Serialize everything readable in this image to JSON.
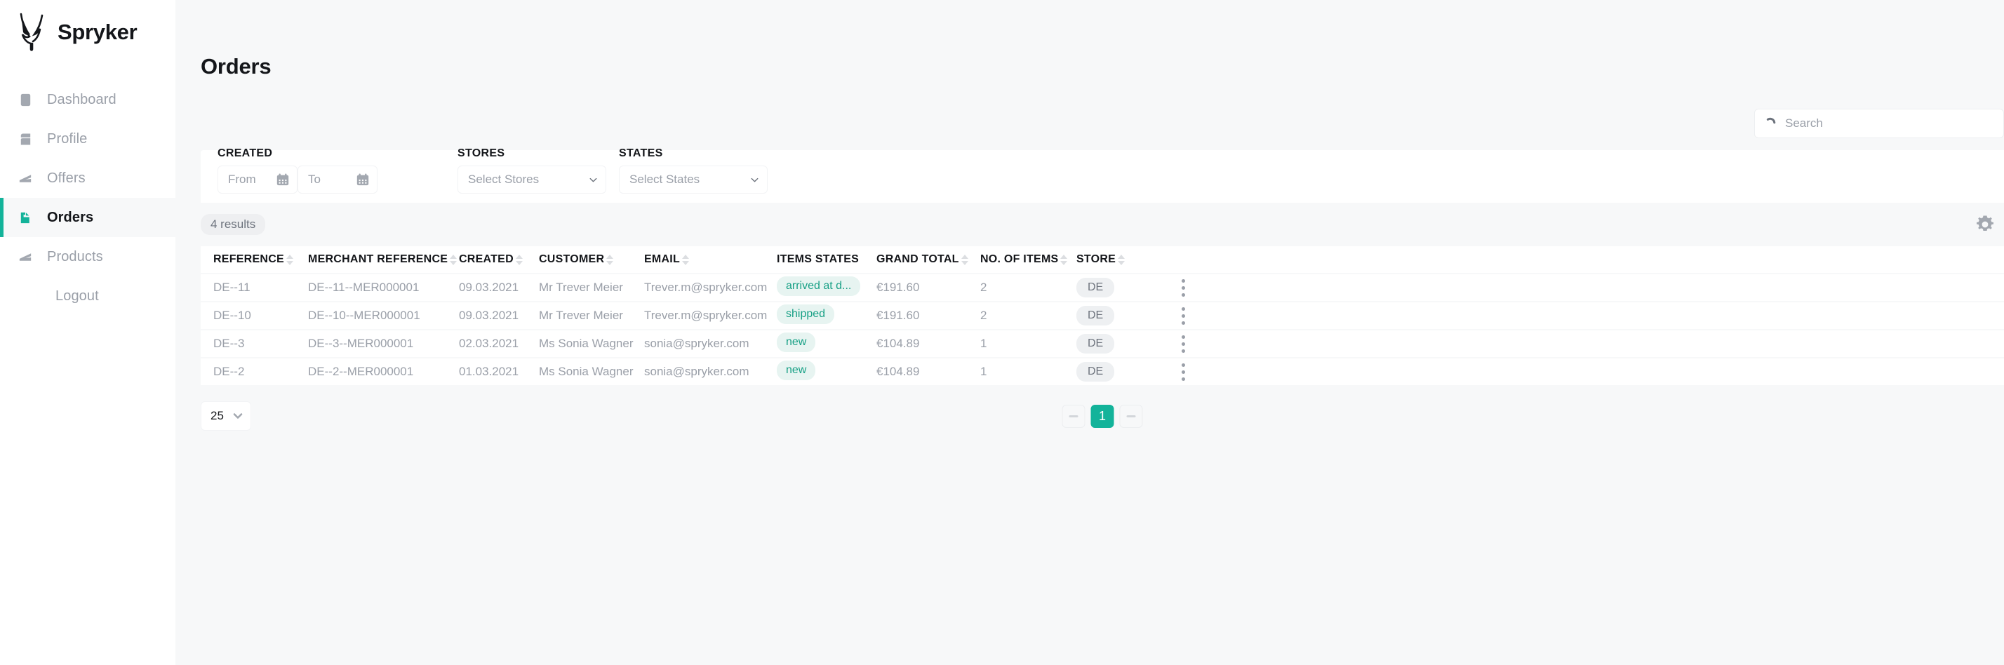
{
  "brand": {
    "name": "Spryker",
    "logo_icon": "spryker-horns-logo"
  },
  "sidebar": {
    "items": [
      {
        "label": "Dashboard",
        "icon": "dashboard-icon",
        "active": false
      },
      {
        "label": "Profile",
        "icon": "profile-icon",
        "active": false
      },
      {
        "label": "Offers",
        "icon": "offers-icon",
        "active": false
      },
      {
        "label": "Orders",
        "icon": "orders-icon",
        "active": true
      },
      {
        "label": "Products",
        "icon": "products-icon",
        "active": false
      },
      {
        "label": "Logout",
        "icon": "none",
        "active": false
      }
    ]
  },
  "header": {
    "title": "Orders"
  },
  "search": {
    "placeholder": "Search",
    "value": "",
    "icon": "search-icon"
  },
  "filters": {
    "created": {
      "label": "CREATED",
      "from_placeholder": "From",
      "to_placeholder": "To",
      "from_value": "",
      "to_value": "",
      "icon": "calendar-icon"
    },
    "stores": {
      "label": "STORES",
      "placeholder": "Select Stores",
      "value": "",
      "icon": "chevron-down-icon"
    },
    "states": {
      "label": "STATES",
      "placeholder": "Select States",
      "value": "",
      "icon": "chevron-down-icon"
    }
  },
  "results": {
    "count_label": "4 results",
    "settings_icon": "gear-icon"
  },
  "table": {
    "columns": [
      {
        "label": "REFERENCE",
        "sortable": true
      },
      {
        "label": "MERCHANT REFERENCE",
        "sortable": true
      },
      {
        "label": "CREATED",
        "sortable": true
      },
      {
        "label": "CUSTOMER",
        "sortable": true
      },
      {
        "label": "EMAIL",
        "sortable": true
      },
      {
        "label": "ITEMS STATES",
        "sortable": false
      },
      {
        "label": "GRAND TOTAL",
        "sortable": true
      },
      {
        "label": "NO. OF ITEMS",
        "sortable": true
      },
      {
        "label": "STORE",
        "sortable": true
      }
    ],
    "rows": [
      {
        "reference": "DE--11",
        "merchant_reference": "DE--11--MER000001",
        "created": "09.03.2021",
        "customer": "Mr Trever Meier",
        "email": "Trever.m@spryker.com",
        "items_state": "arrived at d...",
        "grand_total": "€191.60",
        "no_of_items": "2",
        "store": "DE"
      },
      {
        "reference": "DE--10",
        "merchant_reference": "DE--10--MER000001",
        "created": "09.03.2021",
        "customer": "Mr Trever Meier",
        "email": "Trever.m@spryker.com",
        "items_state": "shipped",
        "grand_total": "€191.60",
        "no_of_items": "2",
        "store": "DE"
      },
      {
        "reference": "DE--3",
        "merchant_reference": "DE--3--MER000001",
        "created": "02.03.2021",
        "customer": "Ms Sonia Wagner",
        "email": "sonia@spryker.com",
        "items_state": "new",
        "grand_total": "€104.89",
        "no_of_items": "1",
        "store": "DE"
      },
      {
        "reference": "DE--2",
        "merchant_reference": "DE--2--MER000001",
        "created": "01.03.2021",
        "customer": "Ms Sonia Wagner",
        "email": "sonia@spryker.com",
        "items_state": "new",
        "grand_total": "€104.89",
        "no_of_items": "1",
        "store": "DE"
      }
    ],
    "row_action_icon": "kebab-menu-icon"
  },
  "pagination": {
    "per_page": "25",
    "per_page_icon": "chevron-down-icon",
    "prev_label": "",
    "current_page": "1",
    "next_label": ""
  },
  "colors": {
    "accent": "#13b39a",
    "badge_state_bg": "#e7f4f1",
    "badge_state_text": "#17a085",
    "badge_store_bg": "#eef0f2",
    "muted_text": "#9a9fa8",
    "page_bg": "#f7f8f9"
  }
}
